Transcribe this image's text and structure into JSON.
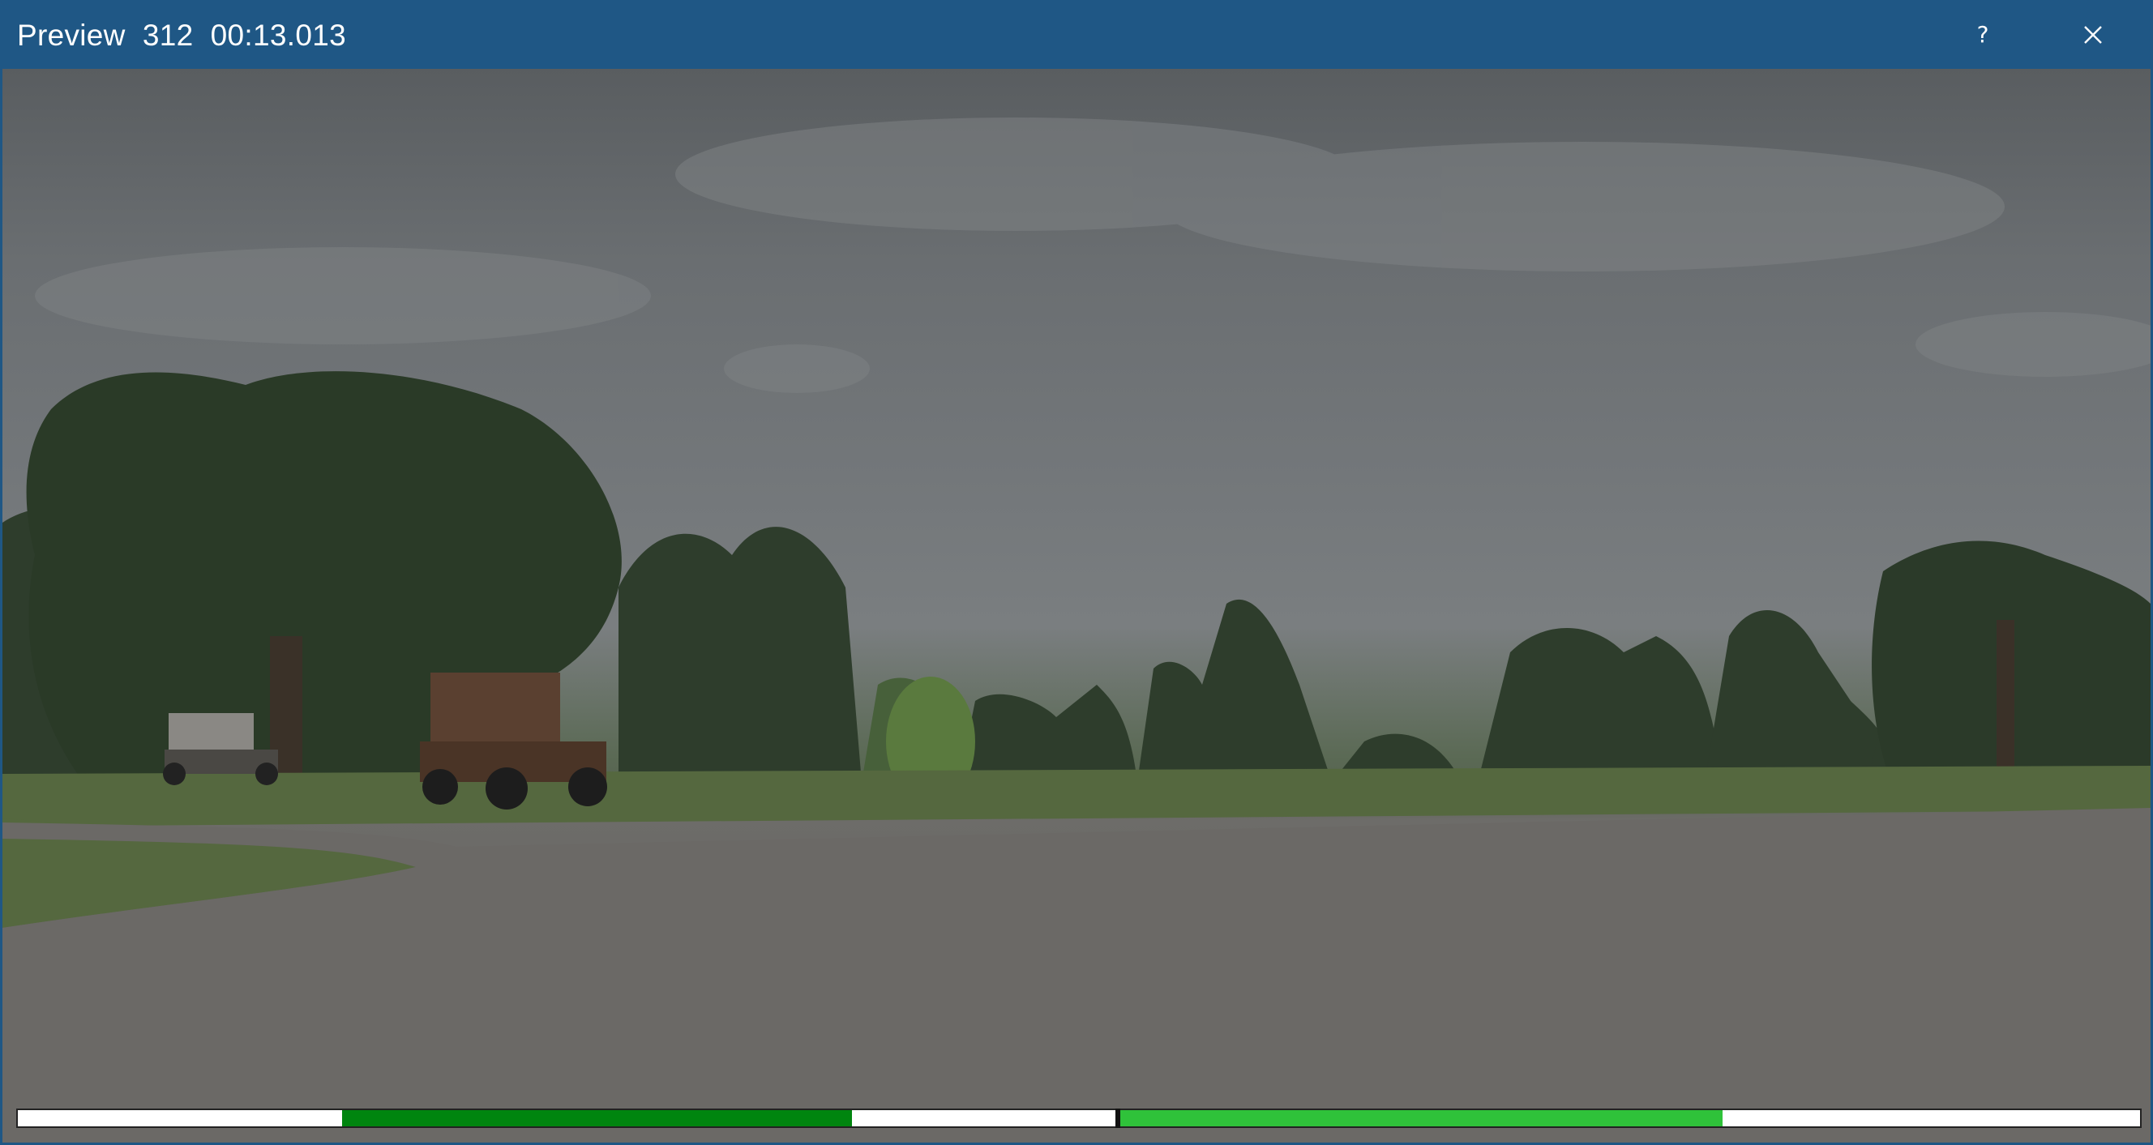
{
  "window": {
    "title": "Preview  312  00:13.013",
    "help_label": "?",
    "close_icon": "close-icon"
  },
  "timeline": {
    "segments": [
      {
        "start": 0.1526,
        "end": 0.3929,
        "color": "#00850f"
      },
      {
        "start": 0.5195,
        "end": 0.8033,
        "color": "#2fc23a"
      }
    ],
    "playhead": 0.517
  },
  "controls": [
    {
      "name": "skip-to-start-button",
      "icon": "triple-chevron-left-icon"
    },
    {
      "name": "fast-rewind-button",
      "icon": "double-chevron-left-icon"
    },
    {
      "name": "step-back-button",
      "icon": "chevron-left-icon"
    },
    {
      "name": "set-in-point-button",
      "icon": "bracket-open-icon"
    },
    {
      "name": "set-out-point-button",
      "icon": "bracket-close-icon"
    },
    {
      "name": "step-forward-button",
      "icon": "chevron-right-icon"
    },
    {
      "name": "fast-forward-button",
      "icon": "double-chevron-right-icon"
    },
    {
      "name": "skip-to-end-button",
      "icon": "triple-chevron-right-icon"
    },
    {
      "name": "cancel-button",
      "icon": "close-icon"
    },
    {
      "name": "confirm-button",
      "icon": "check-chevron-down-icon"
    }
  ],
  "colors": {
    "titlebar": "#1f5785",
    "segment_dark": "#00850f",
    "segment_light": "#2fc23a"
  }
}
